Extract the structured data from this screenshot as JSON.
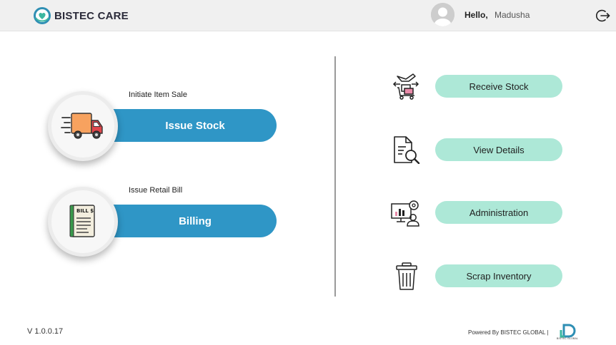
{
  "header": {
    "brand": "BISTEC CARE",
    "greeting": "Hello,",
    "username": "Madusha",
    "logout_icon": "logout-icon"
  },
  "actions": [
    {
      "caption": "Initiate Item Sale",
      "label": "Issue Stock",
      "icon": "delivery-truck-icon"
    },
    {
      "caption": "Issue Retail Bill",
      "label": "Billing",
      "icon": "bill-receipt-icon",
      "icon_text": "BILL $"
    }
  ],
  "side_actions": [
    {
      "label": "Receive Stock",
      "icon": "receive-stock-icon"
    },
    {
      "label": "View Details",
      "icon": "view-details-icon"
    },
    {
      "label": "Administration",
      "icon": "administration-icon"
    },
    {
      "label": "Scrap Inventory",
      "icon": "trash-icon"
    }
  ],
  "footer": {
    "version": "V 1.0.0.17",
    "powered_by": "Powered By BISTEC GLOBAL |",
    "logo_text": "BISTEC GLOBAL"
  },
  "colors": {
    "header_bg": "#f0f0f0",
    "primary_pill": "#2f96c6",
    "secondary_pill": "#ade8d7"
  }
}
